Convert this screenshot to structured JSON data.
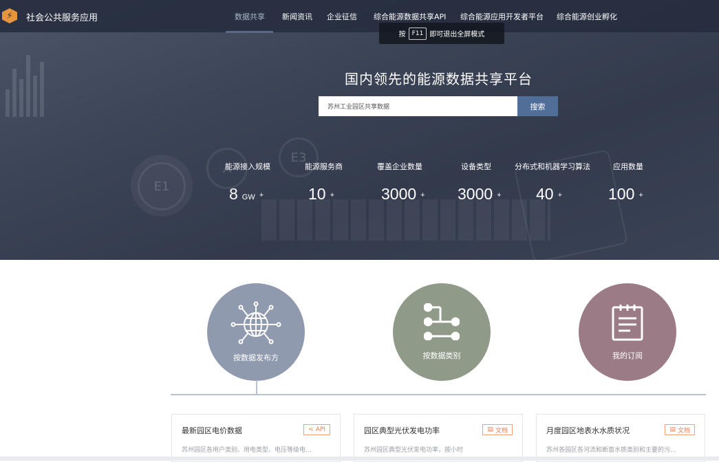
{
  "app": {
    "name": "社会公共服务应用",
    "logo_icon": "lightning-icon"
  },
  "nav": {
    "items": [
      {
        "label": "数据共享",
        "active": true
      },
      {
        "label": "新闻资讯",
        "active": false
      },
      {
        "label": "企业征信",
        "active": false
      },
      {
        "label": "综合能源数据共享API",
        "active": false
      },
      {
        "label": "综合能源应用开发者平台",
        "active": false
      },
      {
        "label": "综合能源创业孵化",
        "active": false
      }
    ]
  },
  "fullscreen_tip": {
    "before": "按",
    "key": "F11",
    "after": "即可退出全屏模式"
  },
  "hero": {
    "headline": "国内领先的能源数据共享平台",
    "search": {
      "value": "苏州工业园区共享数据",
      "button": "搜索"
    }
  },
  "stats": [
    {
      "label": "能源接入规模",
      "value": "8",
      "unit": "GW",
      "plus": "+"
    },
    {
      "label": "能源服务商",
      "value": "10",
      "unit": "",
      "plus": "+"
    },
    {
      "label": "覆盖企业数量",
      "value": "3000",
      "unit": "",
      "plus": "+"
    },
    {
      "label": "设备类型",
      "value": "3000",
      "unit": "",
      "plus": "+"
    },
    {
      "label": "分布式和机器学习算法",
      "value": "40",
      "unit": "",
      "plus": "+"
    },
    {
      "label": "应用数量",
      "value": "100",
      "unit": "",
      "plus": "+"
    }
  ],
  "categories": [
    {
      "label": "按数据发布方",
      "icon": "globe-network-icon",
      "color": "#8f9aae"
    },
    {
      "label": "按数据类别",
      "icon": "flow-diagram-icon",
      "color": "#8f9a88"
    },
    {
      "label": "我的订阅",
      "icon": "clipboard-icon",
      "color": "#9b7b86"
    }
  ],
  "cards": [
    {
      "title": "最新园区电价数据",
      "tag": "API",
      "tag_icon": "share-icon",
      "desc": "苏州园区各用户类别、用电类型、电压等级电..."
    },
    {
      "title": "园区典型光伏发电功率",
      "tag": "文档",
      "tag_icon": "document-icon",
      "desc": "苏州园区典型光伏发电功率，按小时"
    },
    {
      "title": "月度园区地表水水质状况",
      "tag": "文档",
      "tag_icon": "document-icon",
      "desc": "苏州各园区各河流和断面水质类别和主要的污..."
    }
  ],
  "colors": {
    "accent": "#506e97",
    "tag": "#ef7d4a",
    "logo": "#e8963c"
  }
}
